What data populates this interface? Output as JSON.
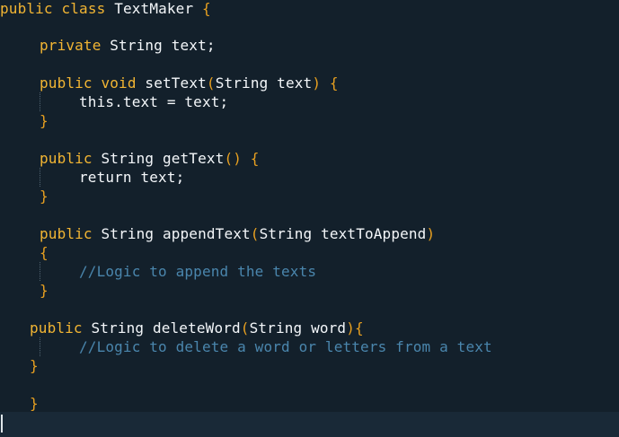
{
  "editor": {
    "colors": {
      "background": "#13202b",
      "keyword": "#f2b533",
      "plain": "#f4f7fa",
      "bracket": "#e8a020",
      "comment": "#4a86ad"
    },
    "lines": [
      {
        "tokens": [
          {
            "t": "public class ",
            "c": "kw"
          },
          {
            "t": "TextMaker",
            "c": "pl"
          },
          {
            "t": " {",
            "c": "br"
          }
        ]
      },
      {
        "tokens": [
          {
            "t": "private ",
            "c": "kw"
          },
          {
            "t": "String text;",
            "c": "pl"
          }
        ]
      },
      {
        "tokens": [
          {
            "t": "public void ",
            "c": "kw"
          },
          {
            "t": "setText",
            "c": "pl"
          },
          {
            "t": "(",
            "c": "br"
          },
          {
            "t": "String text",
            "c": "pl"
          },
          {
            "t": ") {",
            "c": "br"
          }
        ]
      },
      {
        "tokens": [
          {
            "t": "this.text = text;",
            "c": "pl"
          }
        ]
      },
      {
        "tokens": [
          {
            "t": "}",
            "c": "br"
          }
        ]
      },
      {
        "tokens": [
          {
            "t": "public ",
            "c": "kw"
          },
          {
            "t": "String getText",
            "c": "pl"
          },
          {
            "t": "() {",
            "c": "br"
          }
        ]
      },
      {
        "tokens": [
          {
            "t": "return text;",
            "c": "pl"
          }
        ]
      },
      {
        "tokens": [
          {
            "t": "}",
            "c": "br"
          }
        ]
      },
      {
        "tokens": [
          {
            "t": "public ",
            "c": "kw"
          },
          {
            "t": "String appendText",
            "c": "pl"
          },
          {
            "t": "(",
            "c": "br"
          },
          {
            "t": "String textToAppend",
            "c": "pl"
          },
          {
            "t": ")",
            "c": "br"
          }
        ]
      },
      {
        "tokens": [
          {
            "t": "{",
            "c": "br"
          }
        ]
      },
      {
        "tokens": [
          {
            "t": "//Logic to append the texts",
            "c": "cm"
          }
        ]
      },
      {
        "tokens": [
          {
            "t": "}",
            "c": "br"
          }
        ]
      },
      {
        "tokens": [
          {
            "t": "public ",
            "c": "kw"
          },
          {
            "t": "String deleteWord",
            "c": "pl"
          },
          {
            "t": "(",
            "c": "br"
          },
          {
            "t": "String word",
            "c": "pl"
          },
          {
            "t": "){",
            "c": "br"
          }
        ]
      },
      {
        "tokens": [
          {
            "t": "//Logic to delete a word or letters from a text",
            "c": "cm"
          }
        ]
      },
      {
        "tokens": [
          {
            "t": "}",
            "c": "br"
          }
        ]
      },
      {
        "tokens": [
          {
            "t": "}",
            "c": "br"
          }
        ]
      }
    ]
  }
}
